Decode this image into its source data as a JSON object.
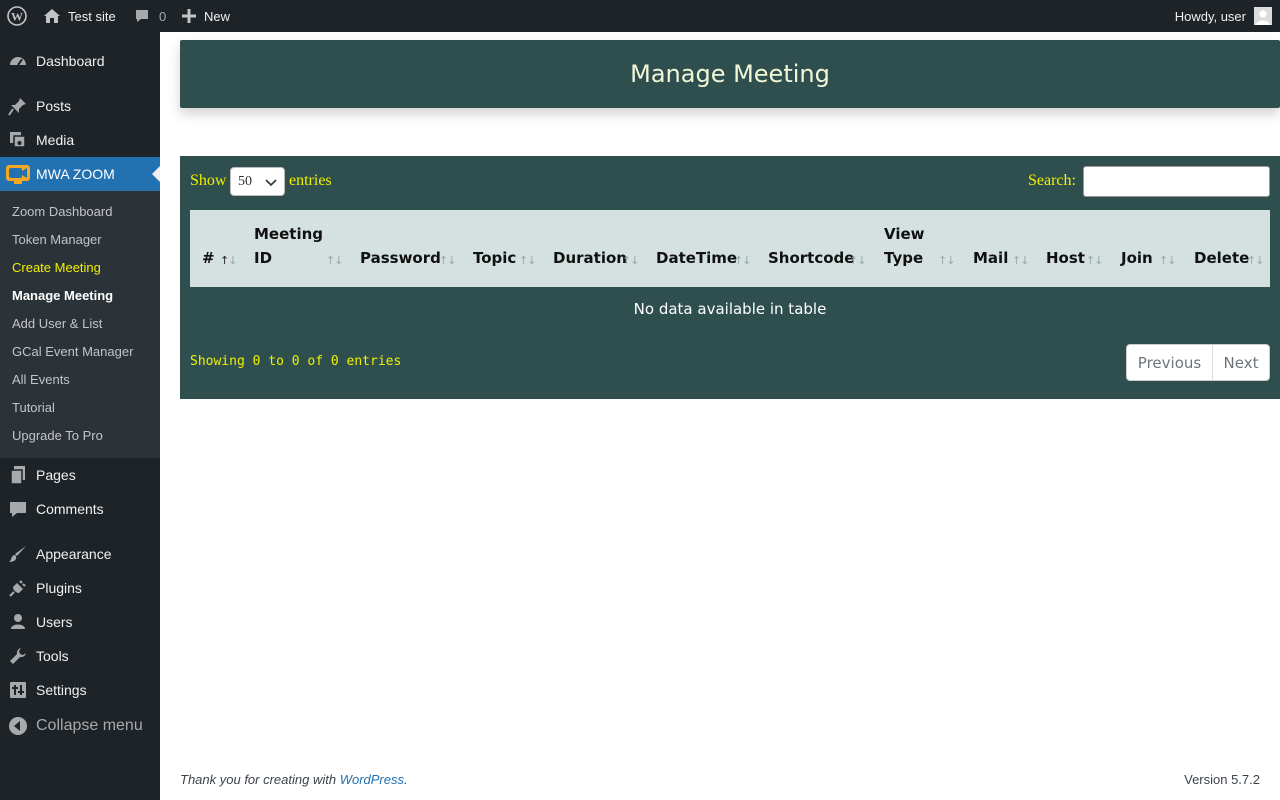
{
  "adminbar": {
    "site_name": "Test site",
    "comments_count": "0",
    "new_label": "New",
    "greeting": "Howdy, user"
  },
  "sidebar": {
    "menu": [
      {
        "label": "Dashboard",
        "icon": "dashboard-icon"
      },
      {
        "label": "Posts",
        "icon": "pushpin-icon"
      },
      {
        "label": "Media",
        "icon": "media-icon"
      },
      {
        "label": "MWA ZOOM",
        "icon": "zoom-camera-icon"
      },
      {
        "label": "Pages",
        "icon": "pages-icon"
      },
      {
        "label": "Comments",
        "icon": "comment-icon"
      },
      {
        "label": "Appearance",
        "icon": "paintbrush-icon"
      },
      {
        "label": "Plugins",
        "icon": "plug-icon"
      },
      {
        "label": "Users",
        "icon": "user-icon"
      },
      {
        "label": "Tools",
        "icon": "wrench-icon"
      },
      {
        "label": "Settings",
        "icon": "settings-icon"
      },
      {
        "label": "Collapse menu",
        "icon": "collapse-icon"
      }
    ],
    "submenu": [
      "Zoom Dashboard",
      "Token Manager",
      "Create Meeting",
      "Manage Meeting",
      "Add User & List",
      "GCal Event Manager",
      "All Events",
      "Tutorial",
      "Upgrade To Pro"
    ]
  },
  "page": {
    "title": "Manage Meeting"
  },
  "table": {
    "show_label": "Show",
    "entries_label": "entries",
    "page_length": "50",
    "search_label": "Search:",
    "columns": [
      [
        "#"
      ],
      [
        "Meeting",
        "ID"
      ],
      [
        "Password"
      ],
      [
        "Topic"
      ],
      [
        "Duration"
      ],
      [
        "DateTime"
      ],
      [
        "Shortcode"
      ],
      [
        "View",
        "Type"
      ],
      [
        "Mail"
      ],
      [
        "Host"
      ],
      [
        "Join"
      ],
      [
        "Delete"
      ]
    ],
    "empty_message": "No data available in table",
    "info": "Showing 0 to 0 of 0 entries",
    "prev_label": "Previous",
    "next_label": "Next"
  },
  "footer": {
    "thanks_prefix": "Thank you for creating with ",
    "thanks_link": "WordPress",
    "thanks_suffix": ".",
    "version": "Version 5.7.2"
  },
  "colors": {
    "admin_dark": "#1d2327",
    "submenu_bg": "#2c3338",
    "active_blue": "#2271b1",
    "panel_green": "#2f4f4f",
    "accent_yellow": "#f0f000",
    "header_row": "#d5e1e0"
  }
}
